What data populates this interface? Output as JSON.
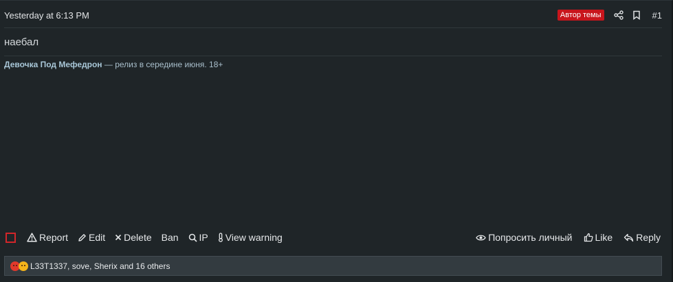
{
  "post": {
    "date": "Yesterday at 6:13 PM",
    "author_badge": "Автор темы",
    "post_number": "#1",
    "message": "наебал",
    "signature": {
      "link_text": "Девочка Под Мефедрон",
      "rest_text": " — релиз в середине июня. 18+"
    }
  },
  "actions": {
    "report": "Report",
    "edit": "Edit",
    "delete": "Delete",
    "ban": "Ban",
    "ip": "IP",
    "view_warning": "View warning",
    "request_private": "Попросить личный",
    "like": "Like",
    "reply": "Reply"
  },
  "reactions": {
    "text": "L33T1337, sove, Sherix and 16 others",
    "icons": [
      "angry-emoji",
      "laughing-emoji"
    ]
  },
  "colors": {
    "background": "#1f2528",
    "badge": "#c8151c",
    "checkbox_border": "#d2262a",
    "signature_link": "#a9c7d8",
    "reaction_bar": "#333b40"
  }
}
